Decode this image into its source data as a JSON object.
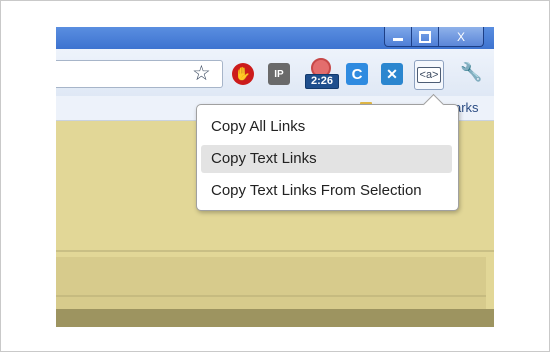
{
  "window": {
    "minimize_symbol": "",
    "close_symbol": "X"
  },
  "toolbar": {
    "star_icon": "☆",
    "ip_label": "IP",
    "clock_badge": "2:26",
    "c_label": "C",
    "x_label": "✕",
    "a_label": "<a>",
    "wrench_icon": "🔧"
  },
  "bookmarks": {
    "text": "arks"
  },
  "menu": {
    "items": [
      "Copy All Links",
      "Copy Text Links",
      "Copy Text Links From Selection"
    ],
    "highlighted_index": 1
  },
  "colors": {
    "titlebar": "#3d73d0",
    "page_background": "#e2d797",
    "menu_highlight": "#e3e3e3"
  }
}
